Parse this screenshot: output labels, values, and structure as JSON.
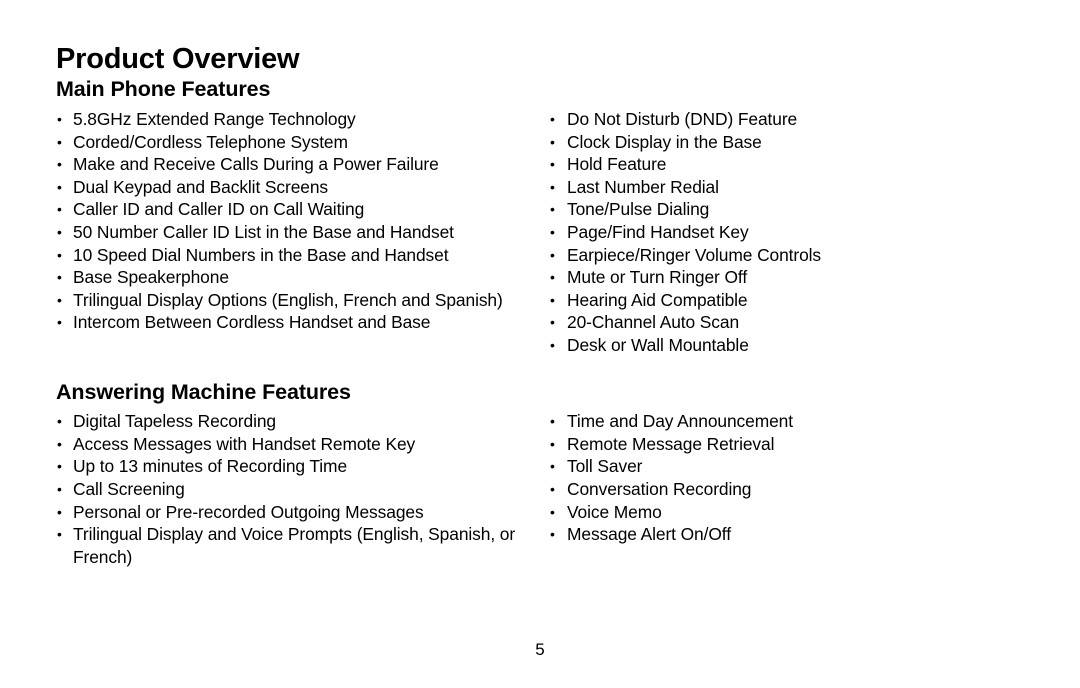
{
  "page": {
    "title": "Product Overview",
    "page_number": "5"
  },
  "sections": [
    {
      "heading": "Main Phone Features",
      "left_items": [
        "5.8GHz Extended Range Technology",
        "Corded/Cordless Telephone System",
        "Make and Receive Calls During a Power Failure",
        "Dual Keypad and Backlit Screens",
        "Caller ID and Caller ID on Call Waiting",
        "50 Number Caller ID List in the Base and Handset",
        "10 Speed Dial Numbers in the Base and Handset",
        "Base Speakerphone",
        "Trilingual Display Options (English, French and Spanish)",
        "Intercom Between Cordless Handset and Base"
      ],
      "right_items": [
        "Do Not Disturb (DND) Feature",
        "Clock Display in the Base",
        "Hold Feature",
        "Last Number Redial",
        "Tone/Pulse Dialing",
        "Page/Find Handset Key",
        "Earpiece/Ringer Volume Controls",
        "Mute or Turn Ringer Off",
        "Hearing Aid Compatible",
        "20-Channel Auto Scan",
        "Desk or Wall Mountable"
      ]
    },
    {
      "heading": "Answering Machine Features",
      "left_items": [
        "Digital Tapeless Recording",
        "Access Messages with Handset Remote Key",
        "Up to 13 minutes of Recording Time",
        "Call Screening",
        "Personal or Pre-recorded Outgoing Messages",
        "Trilingual Display and Voice Prompts (English, Spanish, or French)"
      ],
      "right_items": [
        "Time and Day Announcement",
        "Remote Message Retrieval",
        "Toll Saver",
        "Conversation Recording",
        "Voice Memo",
        "Message Alert On/Off"
      ]
    }
  ]
}
